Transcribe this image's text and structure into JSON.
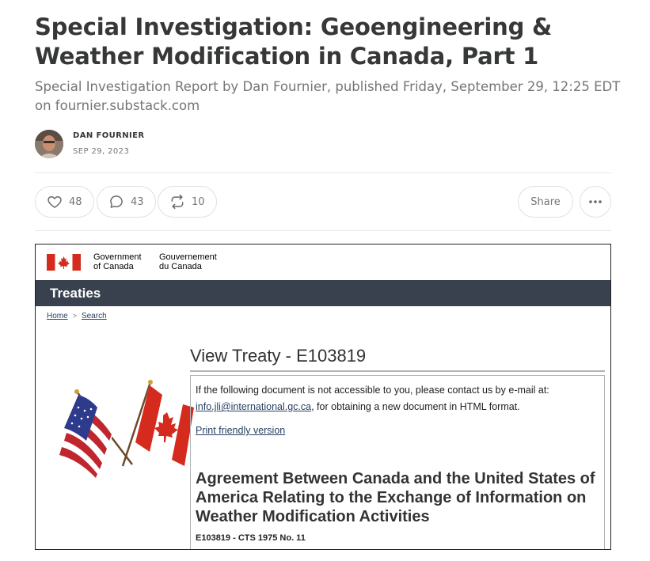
{
  "post": {
    "title": "Special Investigation: Geoengineering & Weather Modification in Canada, Part 1",
    "subtitle": "Special Investigation Report by Dan Fournier, published Friday, September 29, 12:25 EDT on fournier.substack.com",
    "author": "DAN FOURNIER",
    "date": "SEP 29, 2023"
  },
  "actions": {
    "likes": "48",
    "comments": "43",
    "restacks": "10",
    "share_label": "Share",
    "like_icon": "heart-icon",
    "comment_icon": "comment-icon",
    "restack_icon": "restack-icon",
    "more_icon": "ellipsis-icon"
  },
  "embed": {
    "gov_en_line1": "Government",
    "gov_en_line2": "of Canada",
    "gov_fr_line1": "Gouvernement",
    "gov_fr_line2": "du Canada",
    "band_title": "Treaties",
    "breadcrumb": {
      "home": "Home",
      "separator": ">",
      "search": "Search"
    },
    "heading": "View Treaty - E103819",
    "notice_text": "If the following document is not accessible to you, please contact us by e-mail at:",
    "notice_email": "info.jli@international.gc.ca",
    "notice_tail": ", for obtaining a new document in HTML format.",
    "print_link": "Print friendly version",
    "agreement_title": "Agreement Between Canada and the United States of America Relating to the Exchange of Information on Weather Modification Activities",
    "treaty_id": "E103819 - CTS 1975 No. 11"
  },
  "colors": {
    "band": "#38414d",
    "canada_red": "#d52b1e",
    "link": "#284162",
    "us_blue": "#2e3a8c"
  }
}
